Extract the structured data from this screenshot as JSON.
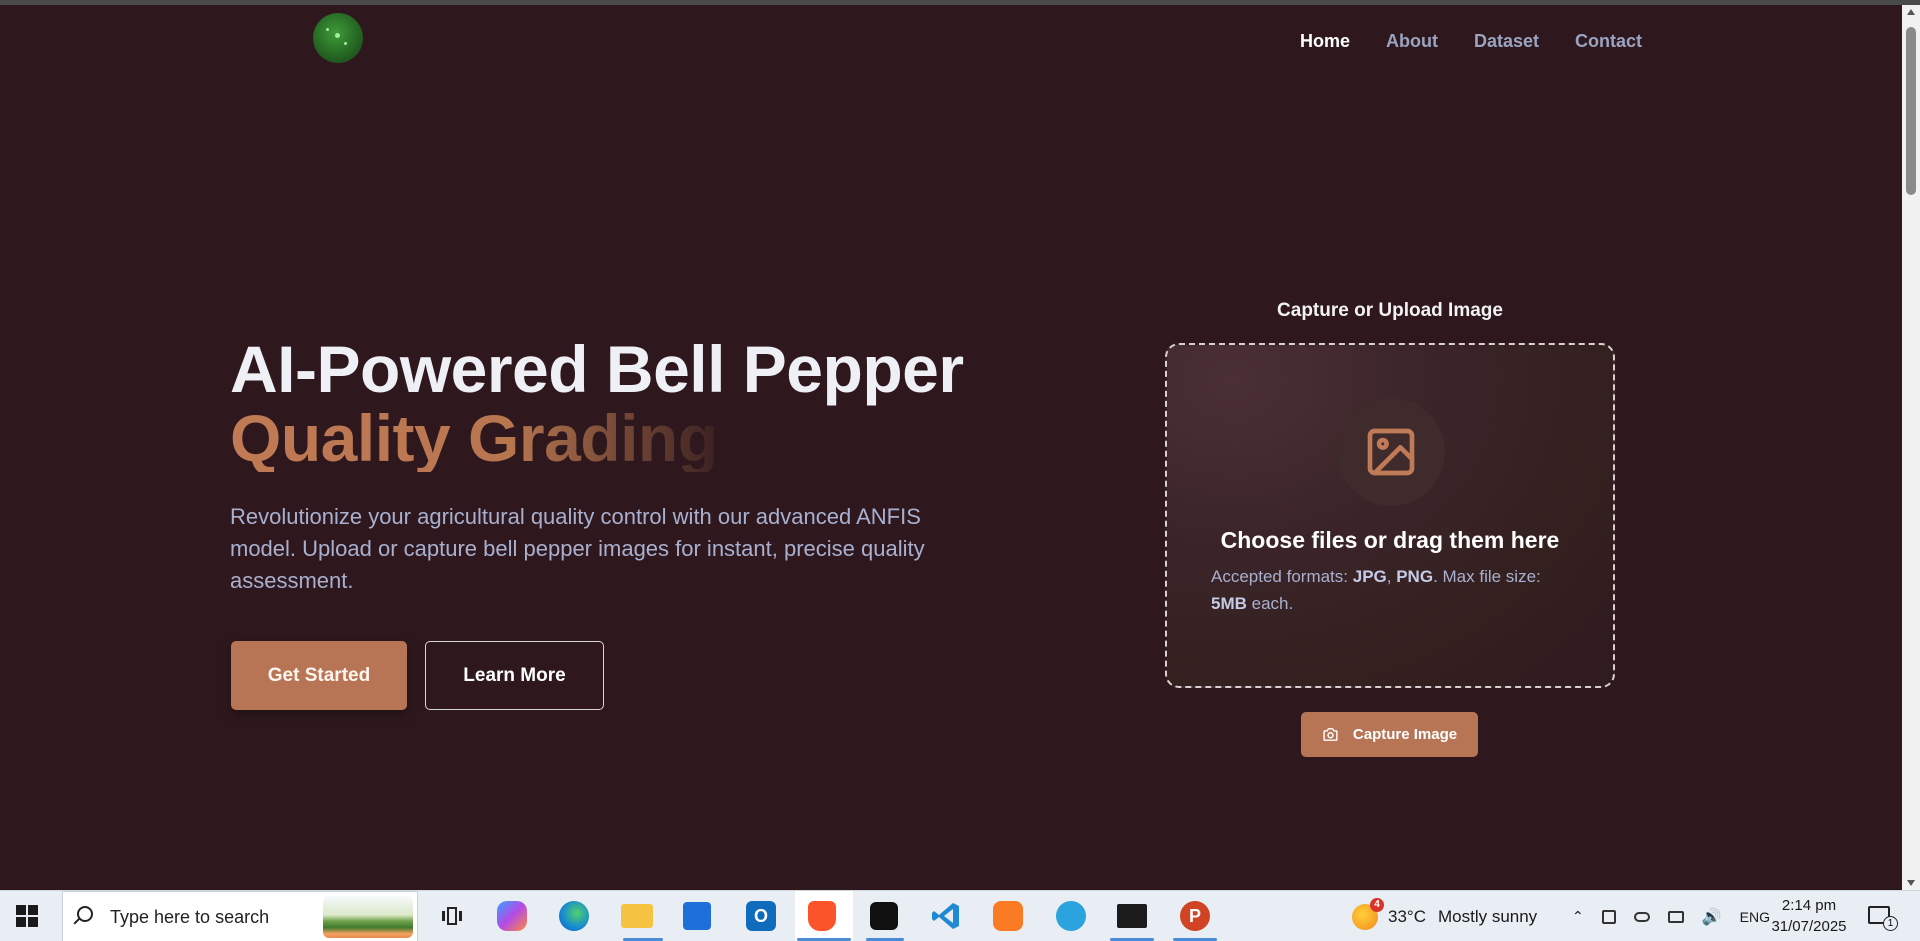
{
  "header": {
    "logo_text": "",
    "nav": [
      {
        "label": "Home",
        "active": true
      },
      {
        "label": "About",
        "active": false
      },
      {
        "label": "Dataset",
        "active": false
      },
      {
        "label": "Contact",
        "active": false
      }
    ]
  },
  "hero": {
    "title": "AI-Powered Bell Pepper",
    "subtitle": "Quality Grading",
    "description": "Revolutionize your agricultural quality control with our advanced ANFIS model. Upload or capture bell pepper images for instant, precise quality assessment.",
    "primary_button": "Get Started",
    "secondary_button": "Learn More"
  },
  "upload": {
    "title": "Capture or Upload Image",
    "icon": "image-icon",
    "main_text": "Choose files or drag them here",
    "formats_prefix": "Accepted formats: ",
    "format_jpg": "JPG",
    "format_sep": ", ",
    "format_png": "PNG",
    "max_size_text": ". Max file size: ",
    "max_size_value": "5MB",
    "max_size_suffix": " each.",
    "capture_button": "Capture Image",
    "capture_icon": "camera-icon"
  },
  "taskbar": {
    "search_placeholder": "Type here to search",
    "weather_badge": "4",
    "weather_temp": "33°C",
    "weather_desc": "Mostly sunny",
    "language": "ENG",
    "time": "2:14 pm",
    "date": "31/07/2025",
    "notification_count": "1"
  },
  "colors": {
    "background": "#2e181d",
    "accent": "#b87555",
    "nav_inactive": "#9aa3c0",
    "body_text": "#a9b0cf"
  }
}
